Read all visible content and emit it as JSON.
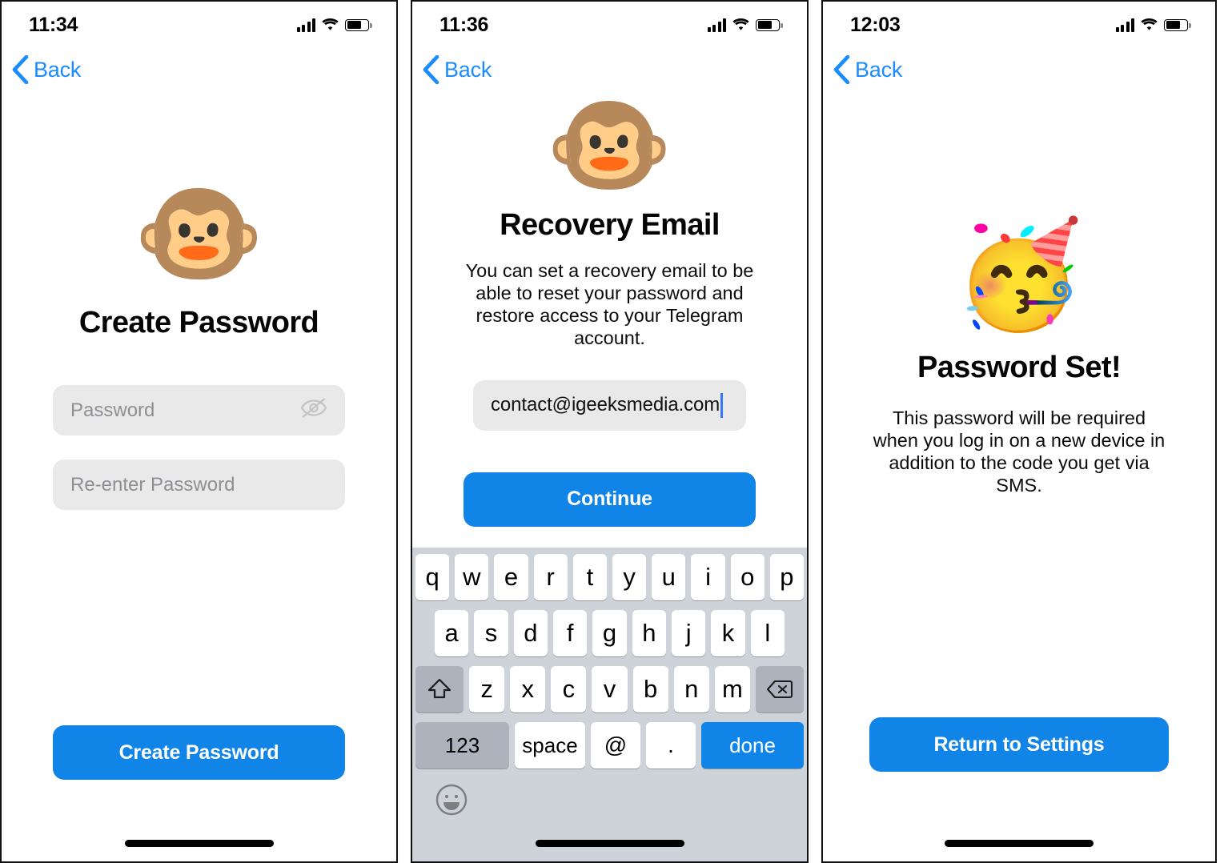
{
  "screens": [
    {
      "status": {
        "time": "11:34",
        "signal_icon": "cellular-signal-icon",
        "wifi_icon": "wifi-icon",
        "battery_icon": "battery-icon"
      },
      "nav": {
        "back_label": "Back",
        "back_icon": "chevron-left-icon"
      },
      "emoji": "🐵",
      "emoji_name": "monkey-face-emoji",
      "title": "Create Password",
      "fields": [
        {
          "name": "password-input",
          "placeholder": "Password",
          "value": "",
          "trailing_icon": "eye-off-icon"
        },
        {
          "name": "confirm-password-input",
          "placeholder": "Re-enter Password",
          "value": "",
          "trailing_icon": ""
        }
      ],
      "button_label": "Create Password"
    },
    {
      "status": {
        "time": "11:36",
        "signal_icon": "cellular-signal-icon",
        "wifi_icon": "wifi-icon",
        "battery_icon": "battery-icon"
      },
      "nav": {
        "back_label": "Back",
        "back_icon": "chevron-left-icon"
      },
      "emoji": "🐵",
      "emoji_name": "monkey-face-emoji",
      "title": "Recovery Email",
      "subtitle": "You can set a recovery email to be able to reset your password and restore access to your Telegram account.",
      "email_field": {
        "name": "recovery-email-input",
        "value": "contact@igeeksmedia.com",
        "placeholder": ""
      },
      "button_label": "Continue",
      "keyboard": {
        "row1": [
          "q",
          "w",
          "e",
          "r",
          "t",
          "y",
          "u",
          "i",
          "o",
          "p"
        ],
        "row2": [
          "a",
          "s",
          "d",
          "f",
          "g",
          "h",
          "j",
          "k",
          "l"
        ],
        "row3": [
          "z",
          "x",
          "c",
          "v",
          "b",
          "n",
          "m"
        ],
        "shift_icon": "shift-key-icon",
        "backspace_icon": "backspace-key-icon",
        "numbers_label": "123",
        "space_label": "space",
        "at_label": "@",
        "period_label": ".",
        "done_label": "done",
        "emoji_key_icon": "emoji-key-icon"
      }
    },
    {
      "status": {
        "time": "12:03",
        "signal_icon": "cellular-signal-icon",
        "wifi_icon": "wifi-icon",
        "battery_icon": "battery-icon"
      },
      "nav": {
        "back_label": "Back",
        "back_icon": "chevron-left-icon"
      },
      "emoji": "🥳",
      "emoji_name": "partying-face-emoji",
      "title": "Password Set!",
      "subtitle": "This password will be required when you log in on a new device in addition to the code you get via SMS.",
      "button_label": "Return to Settings"
    }
  ],
  "colors": {
    "accent_blue": "#1184e8",
    "link_blue": "#1a8cff",
    "field_gray": "#e9e9ea",
    "placeholder_gray": "#8e8e93",
    "keyboard_bg": "#ced2d9",
    "keyboard_modifier": "#adb3bd"
  }
}
